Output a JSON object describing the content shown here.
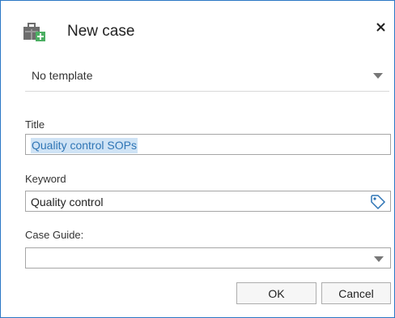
{
  "dialog": {
    "title": "New case",
    "close_icon": "close-icon",
    "case_icon": "case-folder-icon",
    "accent_color": "#2b78c5"
  },
  "template": {
    "selected": "No template"
  },
  "title_field": {
    "label": "Title",
    "value": "Quality control SOPs",
    "selected": true
  },
  "keyword_field": {
    "label": "Keyword",
    "value": "Quality control",
    "icon": "tag-icon"
  },
  "case_guide_field": {
    "label": "Case Guide:",
    "value": ""
  },
  "buttons": {
    "ok": "OK",
    "cancel": "Cancel"
  }
}
